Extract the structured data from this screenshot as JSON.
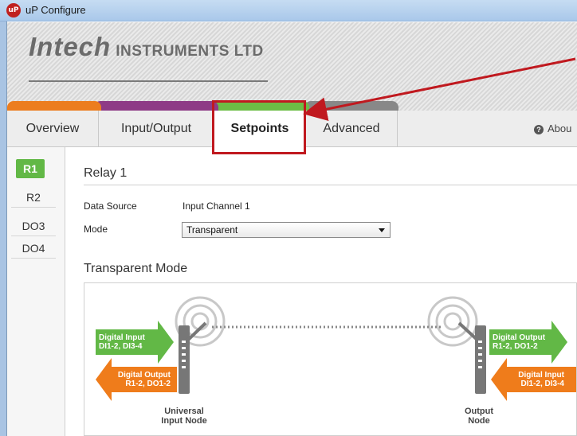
{
  "window": {
    "title": "uP Configure",
    "app_icon_text": "uP"
  },
  "banner": {
    "logo_brand": "Intech",
    "logo_rest": "INSTRUMENTS LTD"
  },
  "tabs": [
    {
      "label": "Overview"
    },
    {
      "label": "Input/Output"
    },
    {
      "label": "Setpoints"
    },
    {
      "label": "Advanced"
    }
  ],
  "about": {
    "label": "Abou"
  },
  "sidebar": {
    "items": [
      {
        "label": "R1"
      },
      {
        "label": "R2"
      },
      {
        "label": "DO3"
      },
      {
        "label": "DO4"
      }
    ]
  },
  "relay": {
    "title": "Relay 1",
    "data_source_label": "Data Source",
    "data_source_value": "Input Channel 1",
    "mode_label": "Mode",
    "mode_value": "Transparent"
  },
  "mode_section": {
    "title": "Transparent Mode"
  },
  "diagram": {
    "left_in": {
      "line1": "Digital Input",
      "line2": "DI1-2, DI3-4"
    },
    "left_out": {
      "line1": "Digital Output",
      "line2": "R1-2, DO1-2"
    },
    "right_out": {
      "line1": "Digital Output",
      "line2": "R1-2, DO1-2"
    },
    "right_in": {
      "line1": "Digital Input",
      "line2": "DI1-2, DI3-4"
    },
    "left_node": {
      "line1": "Universal",
      "line2": "Input Node"
    },
    "right_node": {
      "line1": "Output",
      "line2": "Node"
    }
  },
  "colors": {
    "active_tab_green": "#6cbd45",
    "highlight_red": "#c0191f",
    "arrow_green": "#62b846",
    "arrow_orange": "#ef7c1b"
  }
}
